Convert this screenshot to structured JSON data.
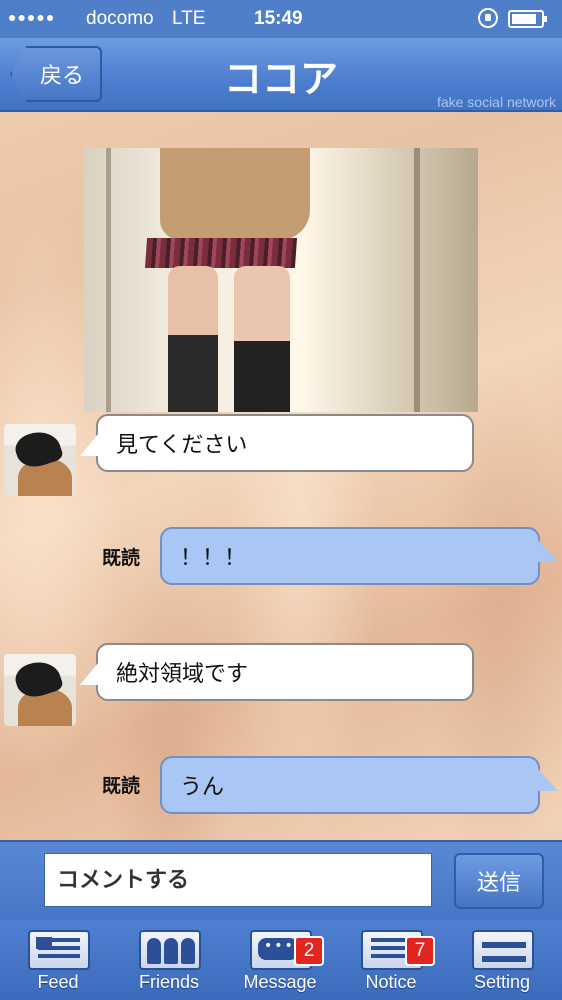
{
  "status_bar": {
    "signal": "●●●●●",
    "carrier": "docomo",
    "network": "LTE",
    "time": "15:49"
  },
  "nav": {
    "back_label": "戻る",
    "title": "ココア",
    "subtitle": "fake social network"
  },
  "messages": [
    {
      "direction": "incoming",
      "text": "見てください"
    },
    {
      "direction": "outgoing",
      "text": "！！！",
      "read_label": "既読"
    },
    {
      "direction": "incoming",
      "text": "絶対領域です"
    },
    {
      "direction": "outgoing",
      "text": "うん",
      "read_label": "既読"
    }
  ],
  "composer": {
    "placeholder": "コメントする",
    "send_label": "送信"
  },
  "tabs": [
    {
      "label": "Feed",
      "icon": "feed-icon"
    },
    {
      "label": "Friends",
      "icon": "friends-icon"
    },
    {
      "label": "Message",
      "icon": "message-icon",
      "badge": "2"
    },
    {
      "label": "Notice",
      "icon": "notice-icon",
      "badge": "7"
    },
    {
      "label": "Setting",
      "icon": "settings-icon"
    }
  ],
  "colors": {
    "accent": "#4f80cf",
    "outgoing_bubble": "#a9c6f5",
    "badge": "#e0261e"
  }
}
